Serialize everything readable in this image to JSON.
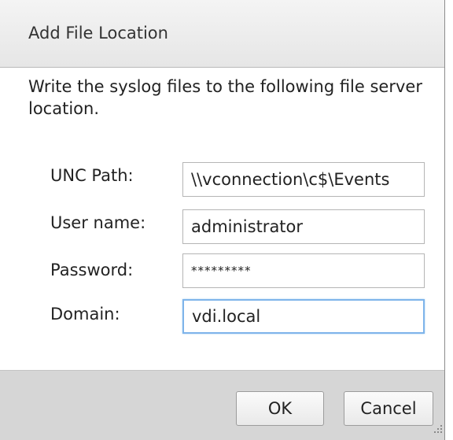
{
  "dialog": {
    "title": "Add File Location",
    "description": "Write the syslog files to the following file server location."
  },
  "fields": {
    "unc_path": {
      "label": "UNC Path:",
      "value": "\\\\vconnection\\c$\\Events"
    },
    "username": {
      "label": "User name:",
      "value": "administrator"
    },
    "password": {
      "label": "Password:",
      "value": "*********"
    },
    "domain": {
      "label": "Domain:",
      "value": "vdi.local"
    }
  },
  "buttons": {
    "ok_label": "OK",
    "cancel_label": "Cancel"
  },
  "icons": {
    "resize": "resize-grip-icon"
  },
  "colors": {
    "focus_border": "#7eb4ea",
    "title_bar": "#e6e6e6",
    "footer": "#d6d6d6"
  }
}
